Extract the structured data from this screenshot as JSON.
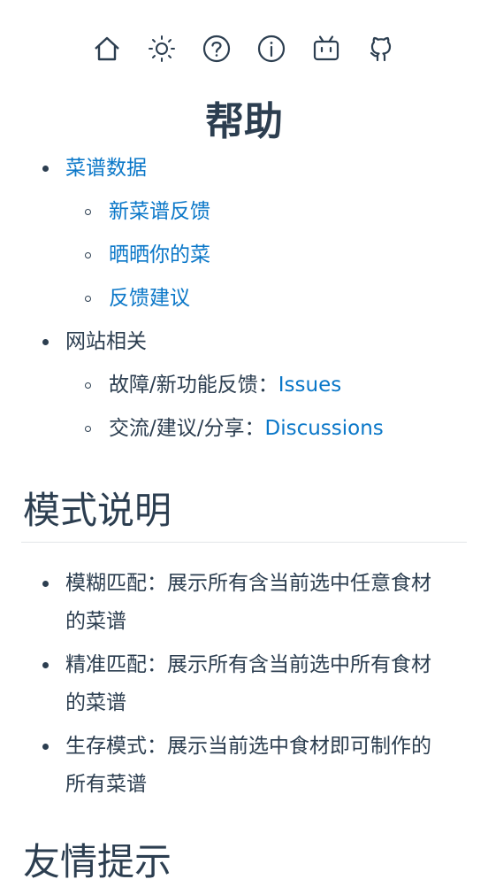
{
  "toolbar": {
    "icons": [
      "home-icon",
      "sun-icon",
      "help-icon",
      "info-icon",
      "bilibili-icon",
      "github-icon"
    ]
  },
  "page": {
    "title": "帮助",
    "sections": {
      "recipe_data": {
        "label": "菜谱数据",
        "children": [
          "新菜谱反馈",
          "晒晒你的菜",
          "反馈建议"
        ]
      },
      "site": {
        "label": "网站相关",
        "issues_prefix": "故障/新功能反馈：",
        "issues_link": "Issues",
        "discussions_prefix": "交流/建议/分享：",
        "discussions_link": "Discussions"
      }
    },
    "mode_heading": "模式说明",
    "modes": [
      {
        "line1": "模糊匹配：展示所有含当前选中任意食材",
        "line2": "的菜谱"
      },
      {
        "line1": "精准匹配：展示所有含当前选中所有食材",
        "line2": "的菜谱"
      },
      {
        "line1": "生存模式：展示当前选中食材即可制作的",
        "line2": "所有菜谱"
      }
    ],
    "tips_heading": "友情提示"
  },
  "colors": {
    "link": "#0a77c8",
    "text": "#2c3e50",
    "divider": "#e3e5e8"
  }
}
